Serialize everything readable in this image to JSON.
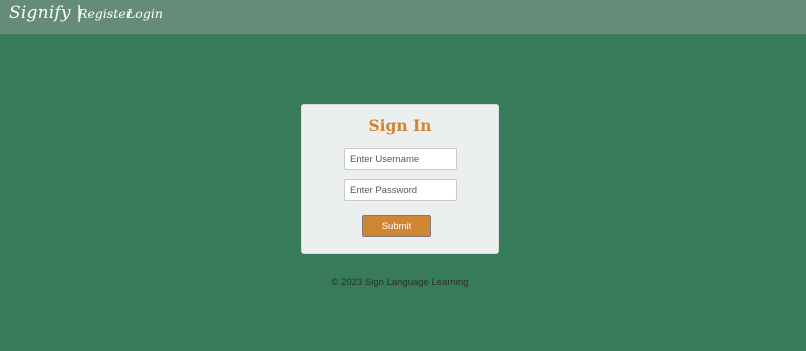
{
  "navbar": {
    "brand": "Signify |",
    "links": [
      {
        "label": "Register"
      },
      {
        "label": "Login"
      }
    ]
  },
  "signin": {
    "title": "Sign In",
    "username_placeholder": "Enter Username",
    "username_value": "",
    "password_placeholder": "Enter Password",
    "password_value": "",
    "submit_label": "Submit"
  },
  "footer": {
    "text": "© 2023 Sign Language Learning"
  },
  "colors": {
    "page_background": "#377b5b",
    "navbar_background": "#658c7b",
    "card_background": "#ebf0ee",
    "title_accent": "#d58433",
    "submit_background": "#d08735"
  }
}
